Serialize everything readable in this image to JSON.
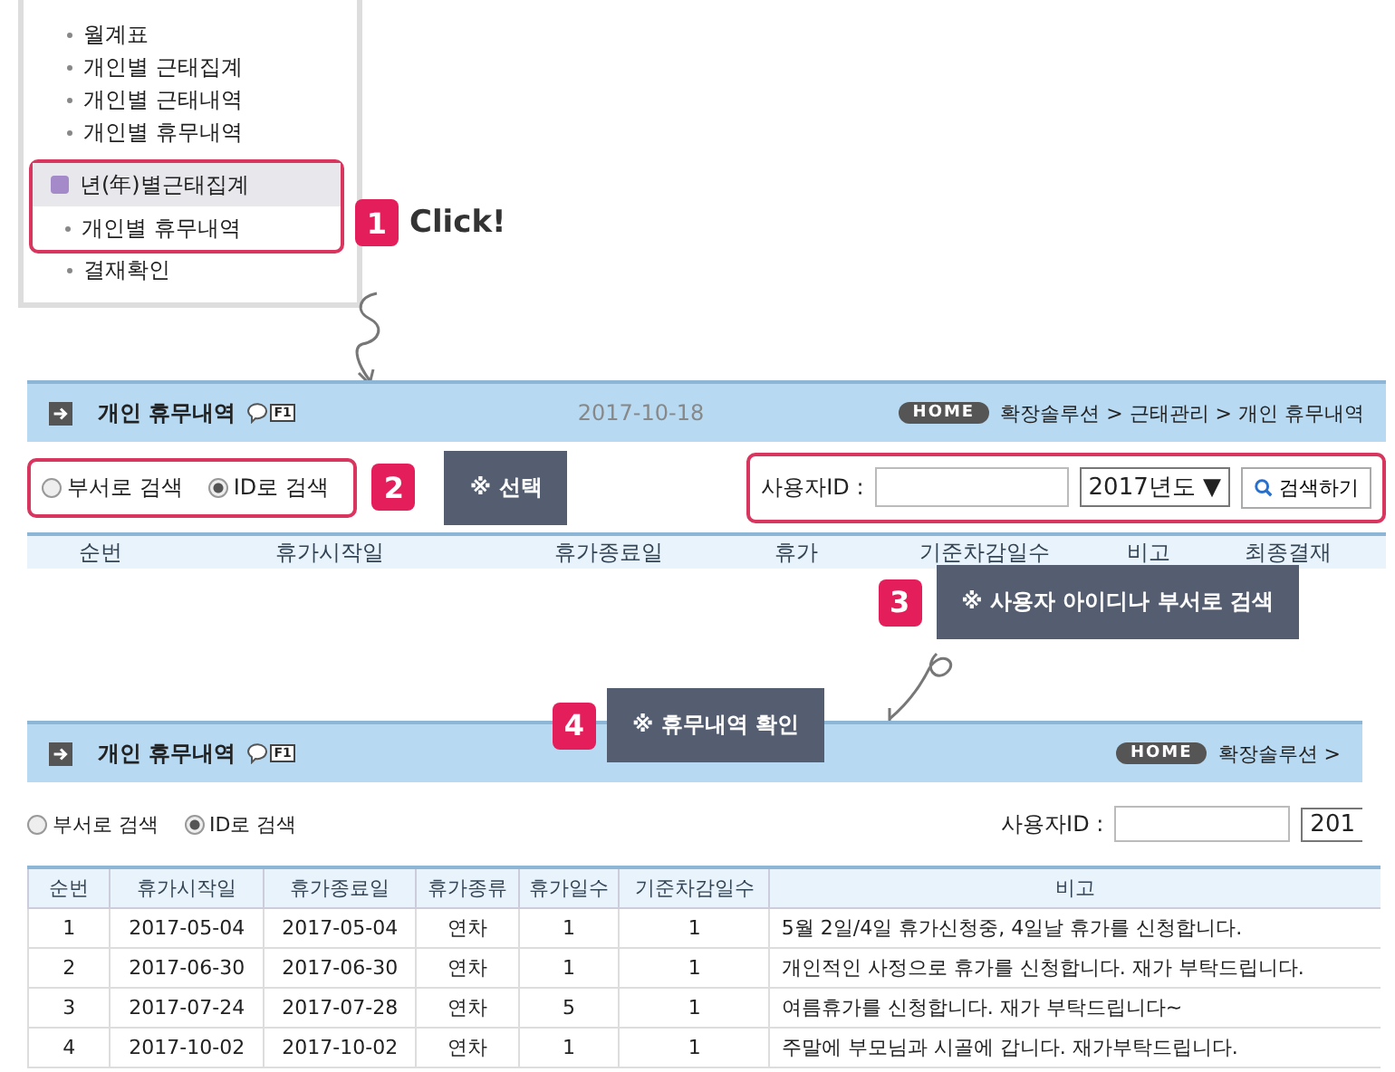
{
  "sidebar_menu": {
    "items": [
      {
        "label": "월계표",
        "kind": "bullet"
      },
      {
        "label": "개인별 근태집계",
        "kind": "bullet"
      },
      {
        "label": "개인별 근태내역",
        "kind": "bullet"
      },
      {
        "label": "개인별 휴무내역",
        "kind": "bullet"
      },
      {
        "label": "년(年)별근태집계",
        "kind": "group"
      },
      {
        "label": "개인별 휴무내역",
        "kind": "bullet"
      },
      {
        "label": "결재확인",
        "kind": "bullet"
      }
    ]
  },
  "steps": [
    {
      "number": "1",
      "text": "Click!",
      "kind": "plain"
    },
    {
      "number": "2",
      "text": "※ 선택",
      "kind": "box"
    },
    {
      "number": "3",
      "text": "※ 사용자 아이디나 부서로 검색",
      "kind": "box"
    },
    {
      "number": "4",
      "text": "※ 휴무내역 확인",
      "kind": "box"
    }
  ],
  "search_screen": {
    "title": "개인 휴무내역",
    "help_badge": "F1",
    "date": "2017-10-18",
    "home_badge": "HOME",
    "breadcrumb": "확장솔루션 > 근태관리 > 개인 휴무내역",
    "radios": [
      {
        "label": "부서로 검색",
        "selected": false
      },
      {
        "label": "ID로 검색",
        "selected": true
      }
    ],
    "user_id_label": "사용자ID :",
    "year": "2017년도",
    "year_caret": "▼",
    "search_button": "검색하기",
    "columns": [
      "순번",
      "휴가시작일",
      "휴가종료일",
      "휴가",
      "기준차감일수",
      "비고",
      "최종결재"
    ]
  },
  "result_screen": {
    "title": "개인 휴무내역",
    "help_badge": "F1",
    "home_badge": "HOME",
    "breadcrumb": "확장솔루션 >",
    "radios": [
      {
        "label": "부서로 검색",
        "selected": false
      },
      {
        "label": "ID로 검색",
        "selected": true
      }
    ],
    "user_id_label": "사용자ID :",
    "year": "201",
    "columns": [
      "순번",
      "휴가시작일",
      "휴가종료일",
      "휴가종류",
      "휴가일수",
      "기준차감일수",
      "비고"
    ],
    "rows": [
      [
        "1",
        "2017-05-04",
        "2017-05-04",
        "연차",
        "1",
        "1",
        "5월 2일/4일 휴가신청중, 4일날 휴가를 신청합니다."
      ],
      [
        "2",
        "2017-06-30",
        "2017-06-30",
        "연차",
        "1",
        "1",
        "개인적인 사정으로 휴가를 신청합니다. 재가 부탁드립니다."
      ],
      [
        "3",
        "2017-07-24",
        "2017-07-28",
        "연차",
        "5",
        "1",
        "여름휴가를 신청합니다. 재가 부탁드립니다~"
      ],
      [
        "4",
        "2017-10-02",
        "2017-10-02",
        "연차",
        "1",
        "1",
        "주말에 부모님과 시골에 갑니다. 재가부탁드립니다."
      ]
    ]
  }
}
